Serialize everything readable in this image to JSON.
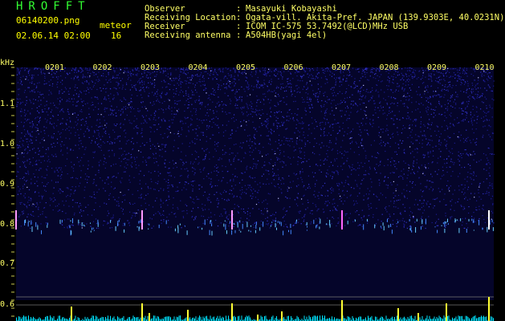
{
  "header": {
    "logo": "HROFFT",
    "filename": "06140200.png",
    "meteor_label": "meteor",
    "datetime": "02.06.14 02:00",
    "meteor_count": "16"
  },
  "station": {
    "observer_label": "Observer",
    "observer_value": "Masayuki Kobayashi",
    "location_label": "Receiving Location",
    "location_value": "Ogata-vill. Akita-Pref. JAPAN (139.9303E, 40.0231N)",
    "receiver_label": "Receiver",
    "receiver_value": "ICOM IC-575 53.7492(@LCD)MHz USB",
    "antenna_label": "Receiving antenna",
    "antenna_value": "A504HB(yagi 4el)",
    "sep": ":"
  },
  "spectrogram": {
    "unit": "kHz",
    "freq_ticks": [
      "1.1",
      "1.0",
      "0.9",
      "0.8",
      "0.7",
      "0.6"
    ],
    "time_labels": [
      "0201",
      "0202",
      "0203",
      "0204",
      "0205",
      "0206",
      "0207",
      "0208",
      "0209",
      "0210"
    ]
  },
  "colors": {
    "text": "#ffff66",
    "logo": "#33ff33",
    "noise": "#1a1a9a",
    "meteor": "#66ccff",
    "histogram": "#ffff33",
    "baseline": "#00e5ff"
  }
}
